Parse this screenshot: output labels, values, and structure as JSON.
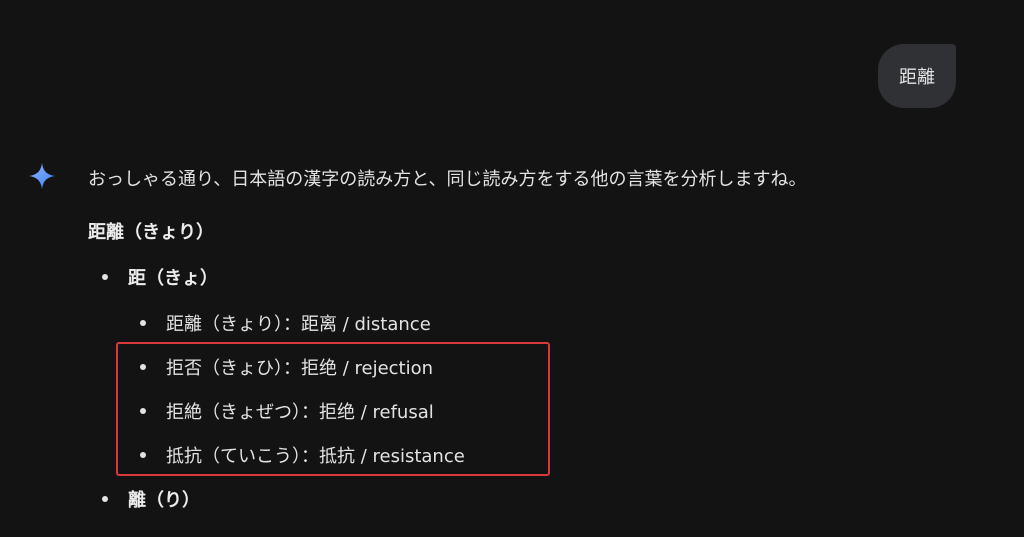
{
  "user_message": {
    "text": "距離"
  },
  "response": {
    "intro": "おっしゃる通り、日本語の漢字の読み方と、同じ読み方をする他の言葉を分析しますね。",
    "section_title": "距離（きょり）",
    "groups": [
      {
        "heading": "距（きょ）",
        "items": [
          "距離（きょり）：距离 / distance",
          "拒否（きょひ）：拒绝 / rejection",
          "拒絶（きょぜつ）：拒绝 / refusal",
          "抵抗（ていこう）：抵抗 / resistance"
        ]
      },
      {
        "heading": "離（り）"
      }
    ]
  },
  "icons": {
    "assistant": "gemini-sparkle-icon"
  },
  "colors": {
    "background": "#131314",
    "user_bubble": "#303134",
    "highlight_border": "#d9393a",
    "sparkle_blue": "#4a8ff7"
  }
}
